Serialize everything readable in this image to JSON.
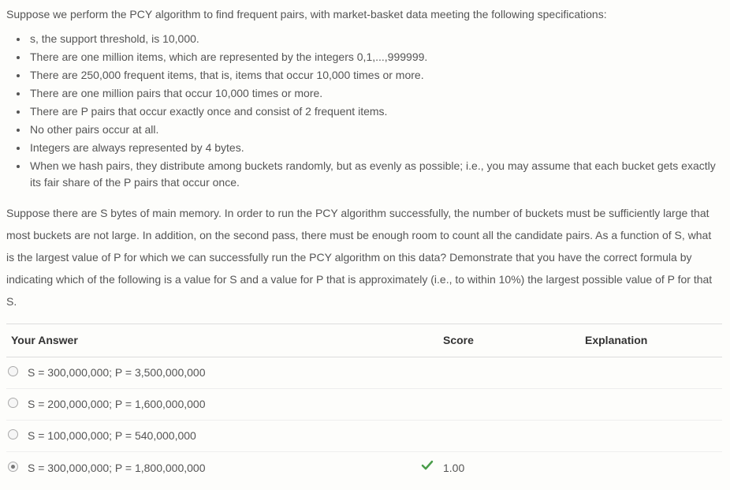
{
  "question": {
    "intro": "Suppose we perform the PCY algorithm to find frequent pairs, with market-basket data meeting the following specifications:",
    "specs": [
      "s, the support threshold, is 10,000.",
      "There are one million items, which are represented by the integers 0,1,...,999999.",
      "There are 250,000 frequent items, that is, items that occur 10,000 times or more.",
      "There are one million pairs that occur 10,000 times or more.",
      "There are P pairs that occur exactly once and consist of 2 frequent items.",
      "No other pairs occur at all.",
      "Integers are always represented by 4 bytes.",
      "When we hash pairs, they distribute among buckets randomly, but as evenly as possible; i.e., you may assume that each bucket gets exactly its fair share of the P pairs that occur once."
    ],
    "body": "Suppose there are S bytes of main memory. In order to run the PCY algorithm successfully, the number of buckets must be sufficiently large that most buckets are not large. In addition, on the second pass, there must be enough room to count all the candidate pairs. As a function of S, what is the largest value of P for which we can successfully run the PCY algorithm on this data? Demonstrate that you have the correct formula by indicating which of the following is a value for S and a value for P that is approximately (i.e., to within 10%) the largest possible value of P for that S."
  },
  "table": {
    "headers": {
      "answer": "Your Answer",
      "score": "Score",
      "explanation": "Explanation"
    },
    "rows": [
      {
        "label": "S = 300,000,000; P = 3,500,000,000",
        "selected": false,
        "correct": false,
        "score": ""
      },
      {
        "label": "S = 200,000,000; P = 1,600,000,000",
        "selected": false,
        "correct": false,
        "score": ""
      },
      {
        "label": "S = 100,000,000; P = 540,000,000",
        "selected": false,
        "correct": false,
        "score": ""
      },
      {
        "label": "S = 300,000,000; P = 1,800,000,000",
        "selected": true,
        "correct": true,
        "score": "1.00"
      }
    ]
  }
}
